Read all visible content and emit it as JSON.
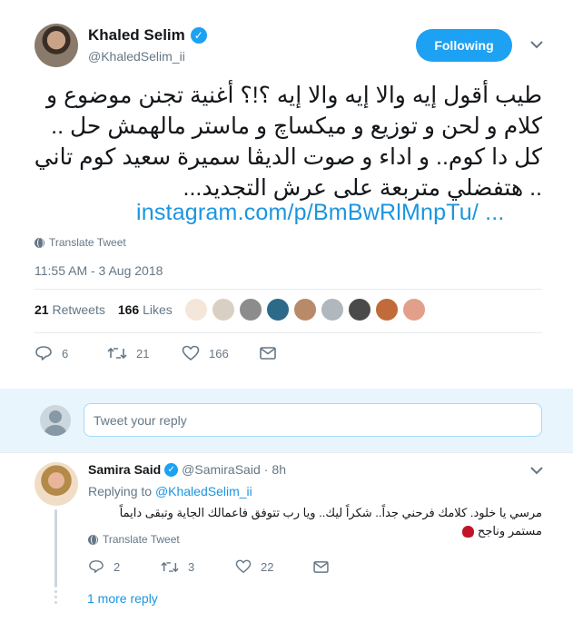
{
  "tweet": {
    "display_name": "Khaled Selim",
    "handle": "@KhaledSelim_ii",
    "follow_label": "Following",
    "text": "طيب أقول إيه والا إيه والا إيه ؟!؟  أغنية تجنن موضوع و كلام و لحن و توزيع و ميكساچ و ماستر مالهمش حل .. كل دا كوم.. و اداء و صوت الديڤا سميرة سعيد كوم تاني .. هتفضلي متربعة على عرش التجديد...",
    "link": "instagram.com/p/BmBwRlMnpTu/  ...",
    "translate_label": "Translate Tweet",
    "timestamp": "11:55 AM - 3 Aug 2018",
    "retweets_count": "21",
    "retweets_label": "Retweets",
    "likes_count": "166",
    "likes_label": "Likes",
    "actions": {
      "replies": "6",
      "retweets": "21",
      "likes": "166"
    },
    "liker_colors": [
      "#f4e6d8",
      "#d9cfc2",
      "#8c8c8c",
      "#2d6a8a",
      "#b88a6a",
      "#b0b7bd",
      "#4a4a4a",
      "#c26b3a",
      "#e2a08a"
    ]
  },
  "composer": {
    "placeholder": "Tweet your reply"
  },
  "reply": {
    "display_name": "Samira Said",
    "handle": "@SamiraSaid",
    "separator": "·",
    "time": "8h",
    "replying_prefix": "Replying to",
    "replying_handle": "@KhaledSelim_ii",
    "text": "مرسي يا خلود. كلامك فرحني جداً.. شكراً ليك.. ويا رب تتوفق فاعمالك الجاية وتبقى دايماً مستمر وناجح",
    "translate_label": "Translate Tweet",
    "actions": {
      "replies": "2",
      "retweets": "3",
      "likes": "22"
    },
    "more_reply": "1 more reply"
  },
  "colors": {
    "accent": "#1da1f2",
    "link": "#1b95e0",
    "muted": "#657786",
    "band": "#e8f5fd"
  }
}
